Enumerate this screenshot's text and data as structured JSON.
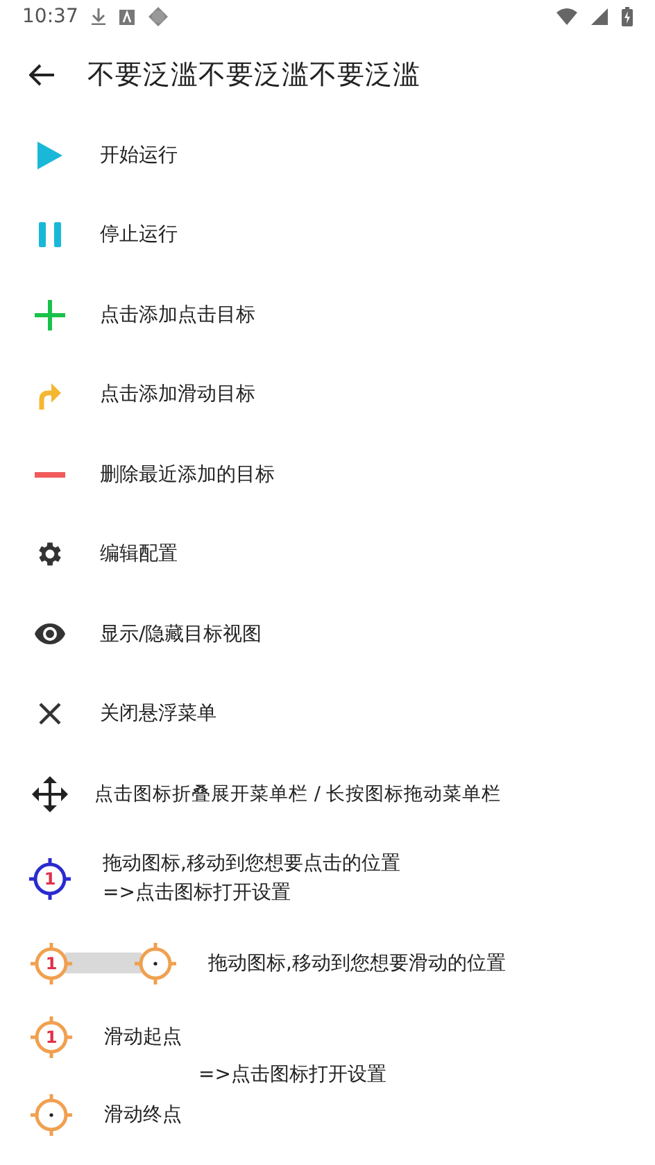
{
  "status_bar": {
    "time": "10:37"
  },
  "app_bar": {
    "title": "不要泛滥不要泛滥不要泛滥"
  },
  "items": [
    {
      "kind": "play",
      "label": "开始运行"
    },
    {
      "kind": "pause",
      "label": "停止运行"
    },
    {
      "kind": "plus",
      "label": "点击添加点击目标"
    },
    {
      "kind": "swipe",
      "label": "点击添加滑动目标"
    },
    {
      "kind": "minus",
      "label": "删除最近添加的目标"
    },
    {
      "kind": "gear",
      "label": "编辑配置"
    },
    {
      "kind": "eye",
      "label": "显示/隐藏目标视图"
    },
    {
      "kind": "close",
      "label": "关闭悬浮菜单"
    },
    {
      "kind": "move",
      "label": "点击图标折叠展开菜单栏 / 长按图标拖动菜单栏"
    }
  ],
  "guide": {
    "click_target": {
      "number": "1",
      "lines": [
        "拖动图标,移动到您想要点击的位置",
        "=>点击图标打开设置"
      ]
    },
    "swipe_target": {
      "number": "1",
      "text": "拖动图标,移动到您想要滑动的位置"
    },
    "swipe_start": {
      "number": "1",
      "label": "滑动起点"
    },
    "hint": "=>点击图标打开设置",
    "swipe_end": {
      "label": "滑动终点"
    }
  }
}
